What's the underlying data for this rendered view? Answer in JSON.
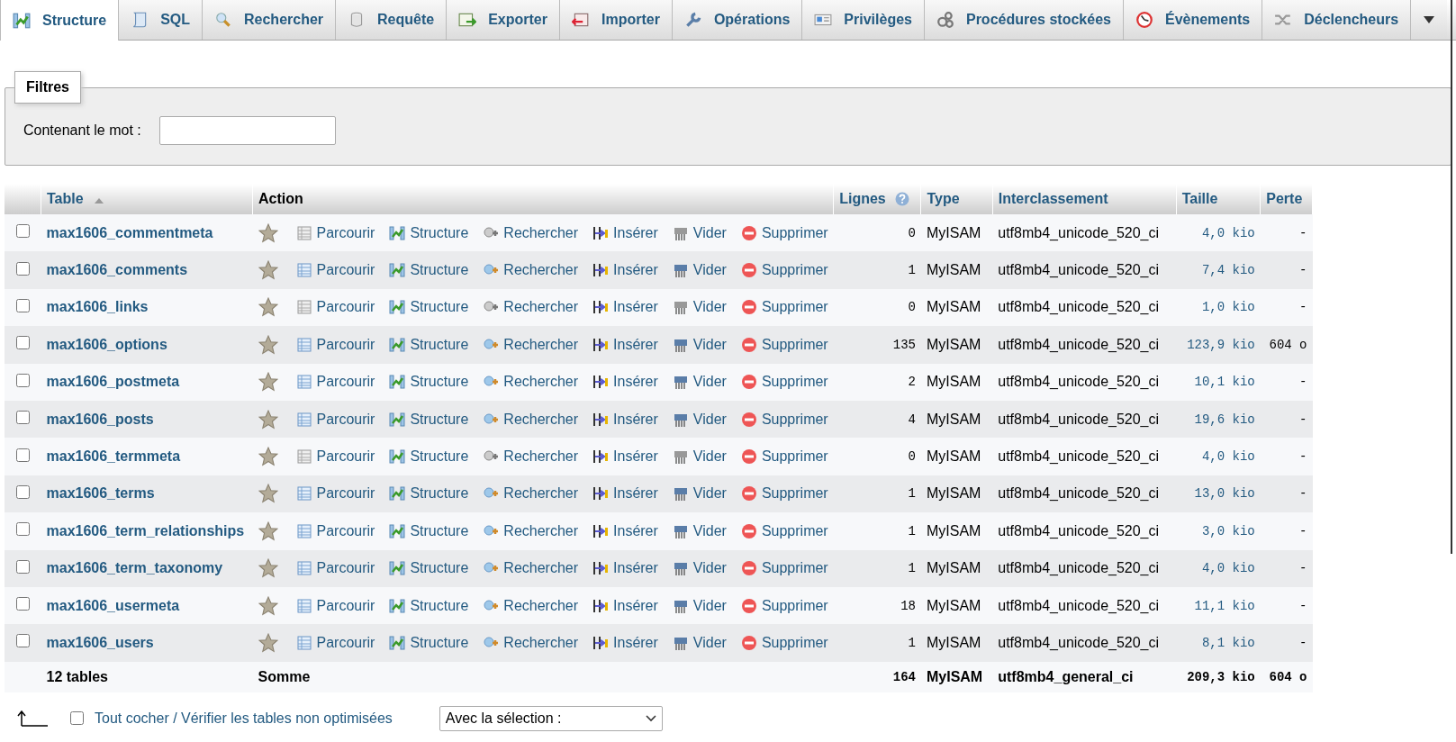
{
  "tabs": [
    {
      "label": "Structure",
      "selected": true
    },
    {
      "label": "SQL",
      "selected": false
    },
    {
      "label": "Rechercher",
      "selected": false
    },
    {
      "label": "Requête",
      "selected": false
    },
    {
      "label": "Exporter",
      "selected": false
    },
    {
      "label": "Importer",
      "selected": false
    },
    {
      "label": "Opérations",
      "selected": false
    },
    {
      "label": "Privilèges",
      "selected": false
    },
    {
      "label": "Procédures stockées",
      "selected": false
    },
    {
      "label": "Évènements",
      "selected": false
    },
    {
      "label": "Déclencheurs",
      "selected": false
    }
  ],
  "filters": {
    "legend": "Filtres",
    "label": "Contenant le mot :"
  },
  "table": {
    "columns": [
      "Table",
      "Action",
      "Lignes",
      "Type",
      "Interclassement",
      "Taille",
      "Perte"
    ],
    "rows": [
      {
        "name": "max1606_commentmeta",
        "checked": false,
        "empty": true,
        "actions": [
          "Parcourir",
          "Structure",
          "Rechercher",
          "Insérer",
          "Vider",
          "Supprimer"
        ],
        "rows": "0",
        "type": "MyISAM",
        "collation": "utf8mb4_unicode_520_ci",
        "size": "4,0 kio",
        "overhead": "-"
      },
      {
        "name": "max1606_comments",
        "checked": false,
        "empty": false,
        "actions": [
          "Parcourir",
          "Structure",
          "Rechercher",
          "Insérer",
          "Vider",
          "Supprimer"
        ],
        "rows": "1",
        "type": "MyISAM",
        "collation": "utf8mb4_unicode_520_ci",
        "size": "7,4 kio",
        "overhead": "-"
      },
      {
        "name": "max1606_links",
        "checked": false,
        "empty": true,
        "actions": [
          "Parcourir",
          "Structure",
          "Rechercher",
          "Insérer",
          "Vider",
          "Supprimer"
        ],
        "rows": "0",
        "type": "MyISAM",
        "collation": "utf8mb4_unicode_520_ci",
        "size": "1,0 kio",
        "overhead": "-"
      },
      {
        "name": "max1606_options",
        "checked": false,
        "empty": false,
        "actions": [
          "Parcourir",
          "Structure",
          "Rechercher",
          "Insérer",
          "Vider",
          "Supprimer"
        ],
        "rows": "135",
        "type": "MyISAM",
        "collation": "utf8mb4_unicode_520_ci",
        "size": "123,9 kio",
        "overhead": "604 o"
      },
      {
        "name": "max1606_postmeta",
        "checked": false,
        "empty": false,
        "actions": [
          "Parcourir",
          "Structure",
          "Rechercher",
          "Insérer",
          "Vider",
          "Supprimer"
        ],
        "rows": "2",
        "type": "MyISAM",
        "collation": "utf8mb4_unicode_520_ci",
        "size": "10,1 kio",
        "overhead": "-"
      },
      {
        "name": "max1606_posts",
        "checked": false,
        "empty": false,
        "actions": [
          "Parcourir",
          "Structure",
          "Rechercher",
          "Insérer",
          "Vider",
          "Supprimer"
        ],
        "rows": "4",
        "type": "MyISAM",
        "collation": "utf8mb4_unicode_520_ci",
        "size": "19,6 kio",
        "overhead": "-"
      },
      {
        "name": "max1606_termmeta",
        "checked": false,
        "empty": true,
        "actions": [
          "Parcourir",
          "Structure",
          "Rechercher",
          "Insérer",
          "Vider",
          "Supprimer"
        ],
        "rows": "0",
        "type": "MyISAM",
        "collation": "utf8mb4_unicode_520_ci",
        "size": "4,0 kio",
        "overhead": "-"
      },
      {
        "name": "max1606_terms",
        "checked": false,
        "empty": false,
        "actions": [
          "Parcourir",
          "Structure",
          "Rechercher",
          "Insérer",
          "Vider",
          "Supprimer"
        ],
        "rows": "1",
        "type": "MyISAM",
        "collation": "utf8mb4_unicode_520_ci",
        "size": "13,0 kio",
        "overhead": "-"
      },
      {
        "name": "max1606_term_relationships",
        "checked": false,
        "empty": false,
        "actions": [
          "Parcourir",
          "Structure",
          "Rechercher",
          "Insérer",
          "Vider",
          "Supprimer"
        ],
        "rows": "1",
        "type": "MyISAM",
        "collation": "utf8mb4_unicode_520_ci",
        "size": "3,0 kio",
        "overhead": "-"
      },
      {
        "name": "max1606_term_taxonomy",
        "checked": false,
        "empty": false,
        "actions": [
          "Parcourir",
          "Structure",
          "Rechercher",
          "Insérer",
          "Vider",
          "Supprimer"
        ],
        "rows": "1",
        "type": "MyISAM",
        "collation": "utf8mb4_unicode_520_ci",
        "size": "4,0 kio",
        "overhead": "-"
      },
      {
        "name": "max1606_usermeta",
        "checked": false,
        "empty": false,
        "actions": [
          "Parcourir",
          "Structure",
          "Rechercher",
          "Insérer",
          "Vider",
          "Supprimer"
        ],
        "rows": "18",
        "type": "MyISAM",
        "collation": "utf8mb4_unicode_520_ci",
        "size": "11,1 kio",
        "overhead": "-"
      },
      {
        "name": "max1606_users",
        "checked": false,
        "empty": false,
        "actions": [
          "Parcourir",
          "Structure",
          "Rechercher",
          "Insérer",
          "Vider",
          "Supprimer"
        ],
        "rows": "1",
        "type": "MyISAM",
        "collation": "utf8mb4_unicode_520_ci",
        "size": "8,1 kio",
        "overhead": "-"
      }
    ],
    "footer": {
      "count": "12 tables",
      "label": "Somme",
      "rows": "164",
      "type": "MyISAM",
      "collation": "utf8mb4_general_ci",
      "size": "209,3 kio",
      "overhead": "604 o"
    }
  },
  "bottom": {
    "checked": false,
    "check_all": "Tout cocher / Vérifier les tables non optimisées",
    "select_placeholder": "Avec la sélection :"
  }
}
